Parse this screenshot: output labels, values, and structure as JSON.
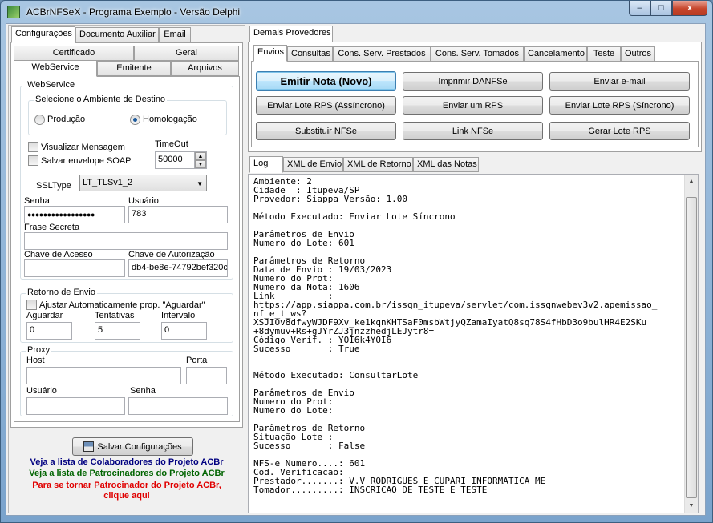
{
  "window": {
    "title": "ACBrNFSeX - Programa Exemplo - Versão Delphi",
    "min_glyph": "–",
    "max_glyph": "□",
    "close_glyph": "x"
  },
  "left_tabs": [
    "Configurações",
    "Documento Auxiliar",
    "Email"
  ],
  "config_tabs_row1": [
    "Certificado",
    "Geral"
  ],
  "config_tabs_row2": [
    "WebService",
    "Emitente",
    "Arquivos"
  ],
  "webservice": {
    "group_title": "WebService",
    "ambiente_title": "Selecione o Ambiente de Destino",
    "ambiente_options": [
      "Produção",
      "Homologação"
    ],
    "ambiente_selected": "Homologação",
    "visualizar_mensagem": "Visualizar Mensagem",
    "salvar_envelope": "Salvar envelope SOAP",
    "timeout_label": "TimeOut",
    "timeout_value": "50000",
    "ssltype_label": "SSLType",
    "ssltype_value": "LT_TLSv1_2",
    "senha_label": "Senha",
    "senha_value": "●●●●●●●●●●●●●●●●●",
    "usuario_label": "Usuário",
    "usuario_value": "783",
    "frase_label": "Frase Secreta",
    "frase_value": "",
    "chave_acesso_label": "Chave de Acesso",
    "chave_acesso_value": "",
    "chave_autorizacao_label": "Chave de Autorização",
    "chave_autorizacao_value": "db4-be8e-74792bef320c"
  },
  "retorno": {
    "title": "Retorno de Envio",
    "ajustar": "Ajustar Automaticamente prop. \"Aguardar\"",
    "aguardar_label": "Aguardar",
    "aguardar_value": "0",
    "tentativas_label": "Tentativas",
    "tentativas_value": "5",
    "intervalo_label": "Intervalo",
    "intervalo_value": "0"
  },
  "proxy": {
    "title": "Proxy",
    "host_label": "Host",
    "porta_label": "Porta",
    "usuario_label": "Usuário",
    "senha_label": "Senha"
  },
  "footer": {
    "salvar_button": "Salvar Configurações",
    "colaboradores": "Veja a lista de Colaboradores do Projeto ACBr",
    "patrocinadores": "Veja a lista de Patrocinadores do Projeto ACBr",
    "patrocinador_line1": "Para se tornar Patrocinador do Projeto ACBr,",
    "patrocinador_line2": "clique aqui",
    "colors": {
      "colaboradores": "#000080",
      "patrocinadores": "#006400",
      "patrocinador": "#e00000"
    }
  },
  "right_top_tab": "Demais Provedores",
  "action_tabs": [
    "Envios",
    "Consultas",
    "Cons. Serv. Prestados",
    "Cons. Serv. Tomados",
    "Cancelamento",
    "Teste",
    "Outros"
  ],
  "buttons": {
    "emitir": "Emitir Nota (Novo)",
    "imprimir": "Imprimir DANFSe",
    "email": "Enviar e-mail",
    "lote_assincrono": "Enviar Lote RPS (Assíncrono)",
    "um_rps": "Enviar um RPS",
    "lote_sincrono": "Enviar Lote RPS (Síncrono)",
    "substituir": "Substituir NFSe",
    "link": "Link NFSe",
    "gerar_lote": "Gerar Lote RPS"
  },
  "log_tabs": [
    "Log",
    "XML de Envio",
    "XML de Retorno",
    "XML das Notas"
  ],
  "log_lines": [
    "Ambiente: 2",
    "Cidade  : Itupeva/SP",
    "Provedor: Siappa Versão: 1.00",
    "",
    "Método Executado: Enviar Lote Síncrono",
    "",
    "Parâmetros de Envio",
    "Numero do Lote: 601",
    "",
    "Parâmetros de Retorno",
    "Data de Envio : 19/03/2023",
    "Numero do Prot:",
    "Numero da Nota: 1606",
    "Link          :",
    "https://app.siappa.com.br/issqn_itupeva/servlet/com.issqnwebev3v2.apemissao_",
    "nf_e_t_ws?",
    "XSJIOv8dfwyWJDF9Xv_ke1kqnKHTSaF0msbWtjyQZamaIyatQ8sq78S4fHbD3o9bulHR4E2SKu",
    "+8dymuv+Rs+gJYrZJ3jnzzhedjLEJytr8=",
    "Código Verif. : YOI6k4YOI6",
    "Sucesso       : True",
    "",
    "",
    "Método Executado: ConsultarLote",
    "",
    "Parâmetros de Envio",
    "Numero do Prot:",
    "Numero do Lote:",
    "",
    "Parâmetros de Retorno",
    "Situação Lote :",
    "Sucesso       : False",
    "",
    "NFS-e Numero....: 601",
    "Cod. Verificacao:",
    "Prestador.......: V.V RODRIGUES E CUPARI INFORMATICA ME",
    "Tomador.........: INSCRICAO DE TESTE E TESTE"
  ]
}
